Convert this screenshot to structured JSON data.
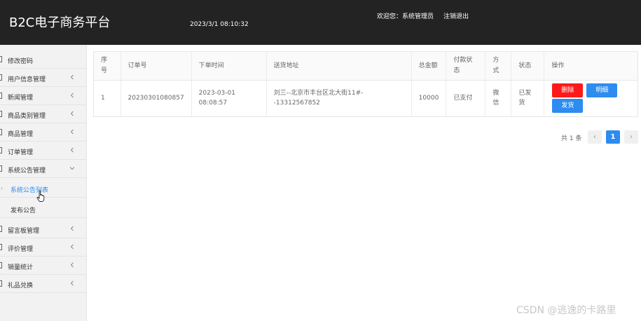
{
  "header": {
    "brand": "B2C电子商务平台",
    "datetime": "2023/3/1 08:10:32",
    "welcome": "欢迎您：系统管理员",
    "logout": "注销退出"
  },
  "sidebar": {
    "items": [
      {
        "label": "修改密码"
      },
      {
        "label": "用户信息管理"
      },
      {
        "label": "新闻管理"
      },
      {
        "label": "商品类别管理"
      },
      {
        "label": "商品管理"
      },
      {
        "label": "订单管理"
      },
      {
        "label": "系统公告管理"
      },
      {
        "label": "系统公告列表"
      },
      {
        "label": "发布公告"
      },
      {
        "label": "留言板管理"
      },
      {
        "label": "评价管理"
      },
      {
        "label": "销量统计"
      },
      {
        "label": "礼品兑换"
      }
    ]
  },
  "table": {
    "headers": [
      "序号",
      "订单号",
      "下单时间",
      "送货地址",
      "总金额",
      "付款状态",
      "方式",
      "状态",
      "操作"
    ],
    "rows": [
      {
        "index": "1",
        "order_no": "20230301080857",
        "order_time": "2023-03-01 08:08:57",
        "address": "刘三--北京市丰台区北大街11#--13312567852",
        "amount": "10000",
        "pay_status": "已支付",
        "method": "微信",
        "status": "已发货",
        "actions": {
          "delete": "删除",
          "detail": "明细",
          "ship": "发货"
        }
      }
    ]
  },
  "pagination": {
    "total": "共 1 条",
    "prev": "‹",
    "current": "1",
    "next": "›"
  },
  "watermark": "CSDN @逃逸的卡路里",
  "colors": {
    "topbar": "#232323",
    "accent": "#2d8cf0",
    "danger": "#ff1a1a"
  }
}
